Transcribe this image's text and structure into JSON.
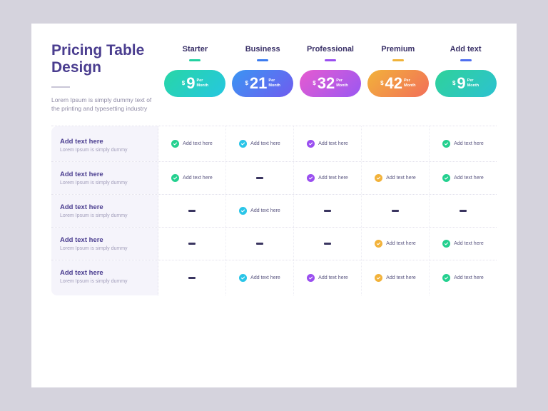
{
  "title": "Pricing Table Design",
  "desc": "Lorem Ipsum is simply dummy text of the printing and typesetting industry",
  "per_label": "Per\nMonth",
  "cell_text": "Add text here",
  "plans": [
    {
      "name": "Starter",
      "price": "9",
      "grad": "g-starter",
      "under": "c-starter",
      "ck": "ck-green"
    },
    {
      "name": "Business",
      "price": "21",
      "grad": "g-business",
      "under": "c-business",
      "ck": "ck-blue"
    },
    {
      "name": "Professional",
      "price": "32",
      "grad": "g-pro",
      "under": "c-pro",
      "ck": "ck-purple"
    },
    {
      "name": "Premium",
      "price": "42",
      "grad": "g-premium",
      "under": "c-premium",
      "ck": "ck-orange"
    },
    {
      "name": "Add text",
      "price": "9",
      "grad": "g-add",
      "under": "c-add",
      "ck": "ck-green"
    }
  ],
  "rows": [
    {
      "title": "Add text here",
      "sub": "Lorem Ipsum is simply dummy",
      "cells": [
        "check",
        "check",
        "check",
        "blank",
        "check"
      ]
    },
    {
      "title": "Add text here",
      "sub": "Lorem Ipsum is simply dummy",
      "cells": [
        "check",
        "dash",
        "check",
        "check",
        "check"
      ]
    },
    {
      "title": "Add text here",
      "sub": "Lorem Ipsum is simply dummy",
      "cells": [
        "dash",
        "check",
        "dash",
        "dash",
        "dash"
      ]
    },
    {
      "title": "Add text here",
      "sub": "Lorem Ipsum is simply dummy",
      "cells": [
        "dash",
        "dash",
        "dash",
        "check",
        "check"
      ]
    },
    {
      "title": "Add text here",
      "sub": "Lorem Ipsum is simply dummy",
      "cells": [
        "dash",
        "check",
        "check",
        "check",
        "check"
      ]
    }
  ]
}
